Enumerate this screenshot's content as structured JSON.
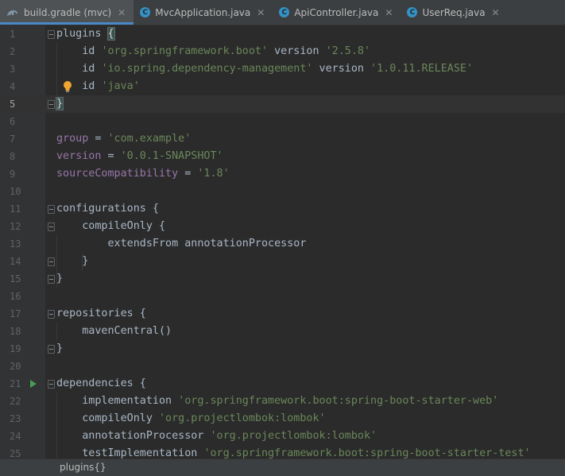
{
  "tabs": [
    {
      "label": "build.gradle (mvc)",
      "icon": "gradle-icon",
      "active": true
    },
    {
      "label": "MvcApplication.java",
      "icon": "class-icon",
      "active": false
    },
    {
      "label": "ApiController.java",
      "icon": "class-icon",
      "active": false
    },
    {
      "label": "UserReq.java",
      "icon": "class-icon",
      "active": false
    }
  ],
  "tab_close_glyph": "✕",
  "class_icon_glyph": "C",
  "editor": {
    "line_numbers": [
      "1",
      "2",
      "3",
      "4",
      "5",
      "6",
      "7",
      "8",
      "9",
      "10",
      "11",
      "12",
      "13",
      "14",
      "15",
      "16",
      "17",
      "18",
      "19",
      "20",
      "21",
      "22",
      "23",
      "24",
      "25"
    ],
    "current_line": "5",
    "lines": {
      "l1_kw": "plugins ",
      "l1_brace": "{",
      "l2_kw": "    id ",
      "l2_str": "'org.springframework.boot'",
      "l2_kw2": " version ",
      "l2_str2": "'2.5.8'",
      "l3_kw": "    id ",
      "l3_str": "'io.spring.dependency-management'",
      "l3_kw2": " version ",
      "l3_str2": "'1.0.11.RELEASE'",
      "l4_kw": "    id ",
      "l4_str": "'java'",
      "l5_brace": "}",
      "l7_prop": "group",
      "l7_eq": " = ",
      "l7_str": "'com.example'",
      "l8_prop": "version",
      "l8_eq": " = ",
      "l8_str": "'0.0.1-SNAPSHOT'",
      "l9_prop": "sourceCompatibility",
      "l9_eq": " = ",
      "l9_str": "'1.8'",
      "l11": "configurations {",
      "l12": "    compileOnly {",
      "l13": "        extendsFrom annotationProcessor",
      "l14": "    }",
      "l15": "}",
      "l17": "repositories {",
      "l18": "    mavenCentral()",
      "l19": "}",
      "l21": "dependencies {",
      "l22_kw": "    implementation ",
      "l22_str": "'org.springframework.boot:spring-boot-starter-web'",
      "l23_kw": "    compileOnly ",
      "l23_str": "'org.projectlombok:lombok'",
      "l24_kw": "    annotationProcessor ",
      "l24_str": "'org.projectlombok:lombok'",
      "l25_kw": "    testImplementation ",
      "l25_str": "'org.springframework.boot:spring-boot-starter-test'"
    }
  },
  "breadcrumb": "plugins{}",
  "colors": {
    "background": "#2b2b2b",
    "string": "#6a8759",
    "property": "#9876aa",
    "text": "#a9b7c6",
    "accent": "#4a88c7"
  }
}
